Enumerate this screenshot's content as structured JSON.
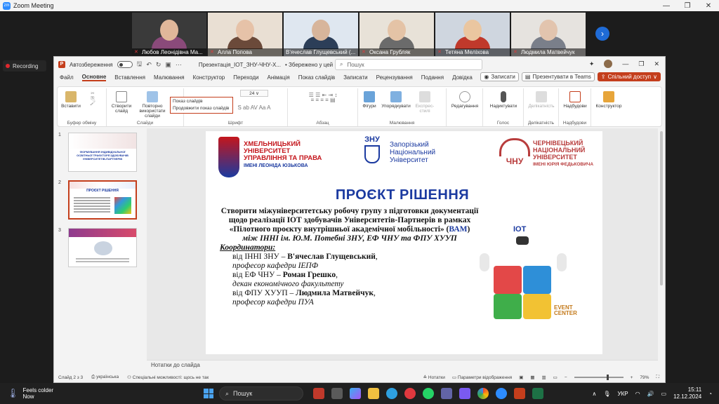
{
  "zoom": {
    "window_title": "Zoom Meeting",
    "recording_label": "Recording",
    "participants": [
      {
        "name": "Любов Леонідівна Ма...",
        "muted": true,
        "bg": "#b58a3a"
      },
      {
        "name": "Алла Попова",
        "muted": true,
        "bg": "#c9a98e"
      },
      {
        "name": "В'ячеслав Глущевський (...",
        "muted": false,
        "bg": "#6a86a8"
      },
      {
        "name": "Оксана Грубляк",
        "muted": true,
        "bg": "#d9cdbd"
      },
      {
        "name": "Тетяна Меліхова",
        "muted": true,
        "bg": "#a8b3c4"
      },
      {
        "name": "Людмила Матвейчук",
        "muted": true,
        "bg": "#d8d4cf"
      }
    ]
  },
  "ppt": {
    "autosave_label": "Автозбереження",
    "file_title": "Презентація_ІОТ_ЗНУ-ЧНУ-Х...",
    "save_status": "• Збережено у цей ПК ∨",
    "search_placeholder": "Пошук",
    "tabs": [
      "Файл",
      "Основне",
      "Вставлення",
      "Малювання",
      "Конструктор",
      "Переходи",
      "Анімація",
      "Показ слайдів",
      "Записати",
      "Рецензування",
      "Подання",
      "Довідка"
    ],
    "active_tab": "Основне",
    "btn_record": "Записати",
    "btn_present_teams": "Презентувати в Teams",
    "btn_share": "Спільний доступ",
    "ribbon": {
      "paste": "Вставити",
      "clipboard_group": "Буфер обміну",
      "new_slide": "Створити слайд",
      "reuse_slides": "Повторно використати слайди",
      "slides_group": "Слайди",
      "slideshow_popup_title": "Показ слайдів",
      "slideshow_popup_item": "Продовжити показ слайдів",
      "font_size": "24",
      "font_group": "Шрифт",
      "paragraph_group": "Абзац",
      "shapes": "Фігури",
      "arrange": "Упорядкувати",
      "quick_styles": "Експрес-стилі",
      "drawing_group": "Малювання",
      "editing": "Редагування",
      "dictate": "Надиктувати",
      "voice_group": "Голос",
      "sensitivity": "Делікатність",
      "sensitivity_group": "Делікатність",
      "addins": "Надбудови",
      "addins_group": "Надбудови",
      "designer": "Конструктор"
    },
    "thumbnails": [
      {
        "num": "1",
        "caption": "ФОРМУВАННЯ ІНДИВІДУАЛЬНОЇ ОСВІТНЬОЇ ТРАЄКТОРІЇ ЗДОБУВАЧІВ УНІВЕРСИТЕТІВ-ПАРТНЕРІВ"
      },
      {
        "num": "2",
        "caption": "ПРОЄКТ РІШЕННЯ"
      },
      {
        "num": "3",
        "caption": ""
      }
    ],
    "slide": {
      "uni1_line1": "ХМЕЛЬНИЦЬКИЙ",
      "uni1_line2": "УНІВЕРСИТЕТ",
      "uni1_line3": "УПРАВЛІННЯ ТА ПРАВА",
      "uni1_sub": "ІМЕНІ ЛЕОНІДА ЮЗЬКОВА",
      "uni2_line1": "Запорізький",
      "uni2_line2": "Національний",
      "uni2_line3": "Університет",
      "uni2_logo": "ЗНУ",
      "uni3_line1": "ЧЕРНІВЕЦЬКИЙ",
      "uni3_line2": "НАЦІОНАЛЬНИЙ",
      "uni3_line3": "УНІВЕРСИТЕТ",
      "uni3_sub": "ІМЕНІ ЮРІЯ ФЕДЬКОВИЧА",
      "uni3_logo": "ЧНУ",
      "title": "ПРОЄКТ РІШЕННЯ",
      "para1": "Створити міжуніверситетську робочу групу з підготовки документації щодо реалізації ІОТ здобувачів Університетів-Партнерів в рамках «Пілотного проєкту внутрішньої академічної мобільності» (ВАМ)",
      "para1_main": "Створити міжуніверситетську робочу групу з підготовки документації щодо реалізації ІОТ здобувачів Університетів-Партнерів в рамках «Пілотного проєкту внутрішньої академічної мобільності» (",
      "para1_vam": "ВАМ",
      "para1_end": ")",
      "para2": "між ІННІ ім. Ю.М. Потебні ЗНУ, ЕФ ЧНУ та ФПУ ХУУП",
      "coord_label": "Координатори:",
      "coord1_prefix": "від ІННІ ЗНУ – ",
      "coord1_name": "В'ячеслав Глущевський",
      "coord1_role": "професор кафедри ІЕПФ",
      "coord2_prefix": "від ЕФ ЧНУ – ",
      "coord2_name": "Роман Грешко",
      "coord2_role": "декан економічного факультету",
      "coord3_prefix": "від ФПУ ХУУП – ",
      "coord3_name": "Людмила Матвейчук",
      "coord3_role": "професор кафедри ПУА",
      "illus_label": "ІОТ",
      "illus_brand": "EVENT CENTER"
    },
    "notes_label": "Нотатки до слайда",
    "status": {
      "slide_counter": "Слайд 2 з 3",
      "language": "українська",
      "accessibility": "Спеціальні можливості: щось не так",
      "notes": "Нотатки",
      "display_settings": "Параметри відображення",
      "zoom": "79%"
    }
  },
  "taskbar": {
    "weather_temp": "🌡",
    "weather_line1": "Feels colder",
    "weather_line2": "Now",
    "search_label": "Пошук",
    "lang": "УКР",
    "time": "15:11",
    "date": "12.12.2024"
  }
}
